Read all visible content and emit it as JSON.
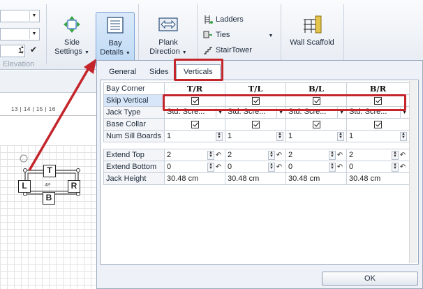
{
  "ribbon": {
    "elevation_value": "1",
    "elevation_group_label": "Elevation",
    "side_settings_label": "Side\nSettings",
    "bay_details_label": "Bay\nDetails",
    "plank_direction_label": "Plank\nDirection",
    "ladders_label": "Ladders",
    "ties_label": "Ties",
    "stairtower_label": "StairTower",
    "wall_scaffold_label": "Wall Scaffold",
    "dropdown_arrow": "▼"
  },
  "canvas": {
    "ruler_text": "13  |  14  |  15  |  16",
    "labels": {
      "top": "T",
      "left": "L",
      "right": "R",
      "bottom": "B",
      "center": "4P"
    }
  },
  "dialog": {
    "tabs": [
      "General",
      "Sides",
      "Verticals"
    ],
    "active_tab": "Verticals",
    "columns": [
      "T/R",
      "T/L",
      "B/L",
      "B/R"
    ],
    "header_label": "Bay Corner",
    "rows": {
      "skip_vertical": {
        "label": "Skip Vertical",
        "checked": [
          true,
          true,
          true,
          true
        ]
      },
      "jack_type": {
        "label": "Jack Type",
        "values": [
          "Std. Scre...",
          "Std. Scre...",
          "Std. Scre...",
          "Std. Scre..."
        ]
      },
      "base_collar": {
        "label": "Base Collar",
        "checked": [
          true,
          true,
          true,
          true
        ]
      },
      "num_sill_boards": {
        "label": "Num Sill Boards",
        "values": [
          "1",
          "1",
          "1",
          "1"
        ]
      },
      "extend_top": {
        "label": "Extend Top",
        "values": [
          "2",
          "2",
          "2",
          "2"
        ]
      },
      "extend_bottom": {
        "label": "Extend Bottom",
        "values": [
          "0",
          "0",
          "0",
          "0"
        ]
      },
      "jack_height": {
        "label": "Jack Height",
        "values": [
          "30.48 cm",
          "30.48 cm",
          "30.48 cm",
          "30.48 cm"
        ]
      }
    },
    "ok_label": "OK"
  },
  "colors": {
    "annotation_red": "#c4252b",
    "ribbon_active": "#bcd8f5"
  }
}
